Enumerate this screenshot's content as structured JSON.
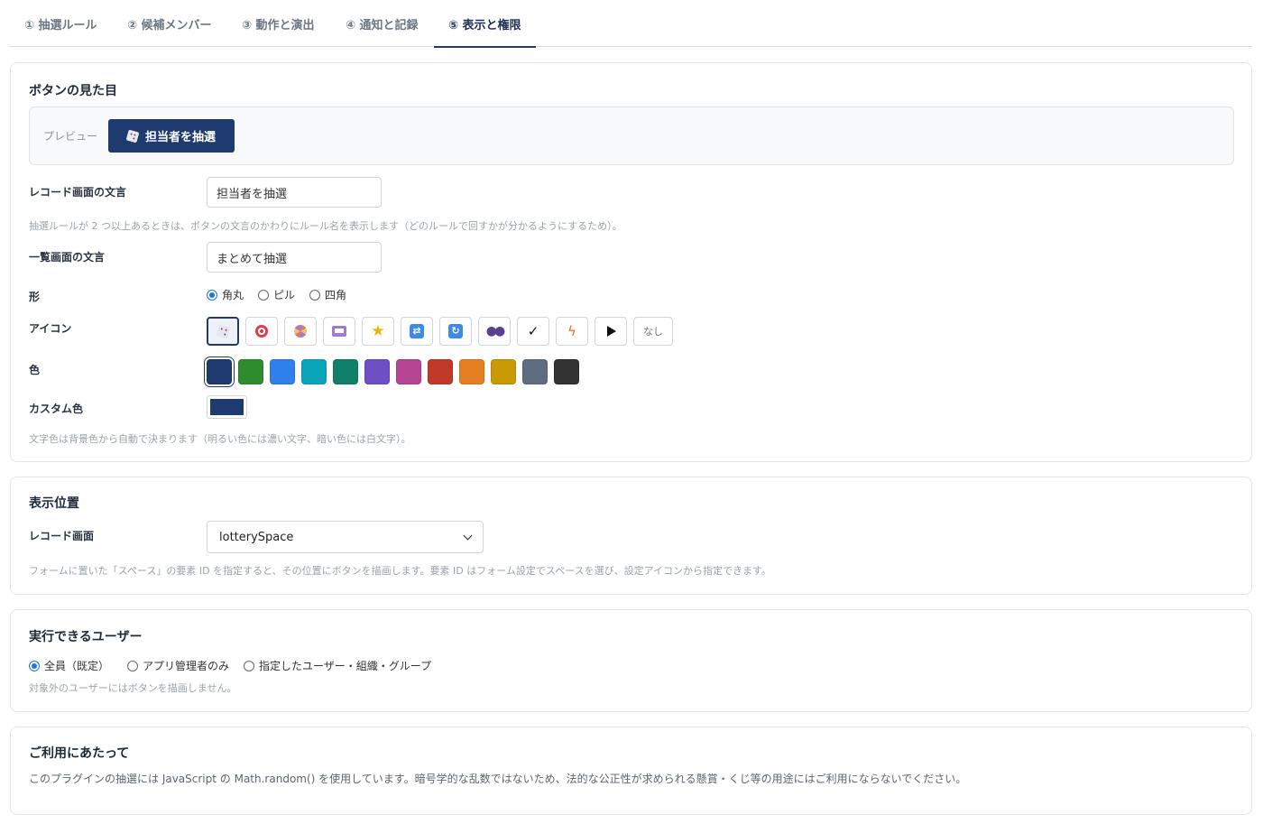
{
  "tabs": [
    {
      "label": "① 抽選ルール"
    },
    {
      "label": "② 候補メンバー"
    },
    {
      "label": "③ 動作と演出"
    },
    {
      "label": "④ 通知と記録"
    },
    {
      "label": "⑤ 表示と権限"
    }
  ],
  "appearance": {
    "title": "ボタンの見た目",
    "preview_label": "プレビュー",
    "preview_button_label": "担当者を抽選",
    "record_label": "レコード画面の文言",
    "record_value": "担当者を抽選",
    "record_hint": "抽選ルールが 2 つ以上あるときは、ボタンの文言のかわりにルール名を表示します（どのルールで回すかが分かるようにするため）。",
    "list_label": "一覧画面の文言",
    "list_value": "まとめて抽選",
    "shape_label": "形",
    "shapes": [
      {
        "label": "角丸",
        "checked": true
      },
      {
        "label": "ピル",
        "checked": false
      },
      {
        "label": "四角",
        "checked": false
      }
    ],
    "icon_label": "アイコン",
    "icons": [
      "dice",
      "target",
      "wheel",
      "slot-machine",
      "star",
      "shuffle",
      "refresh",
      "users",
      "check",
      "bolt",
      "play",
      "none"
    ],
    "icon_none_label": "なし",
    "color_label": "色",
    "colors": [
      "#1e3a6e",
      "#2e8b2e",
      "#2f80ed",
      "#0aa5b8",
      "#11806b",
      "#6f4fc4",
      "#b54593",
      "#c0392b",
      "#e67e22",
      "#c99a06",
      "#5e6e80",
      "#333333"
    ],
    "custom_color_label": "カスタム色",
    "custom_color": "#1e3a6e",
    "color_hint": "文字色は背景色から自動で決まります（明るい色には濃い文字、暗い色には白文字）。"
  },
  "position": {
    "title": "表示位置",
    "record_label": "レコード画面",
    "select_value": "lotterySpace",
    "hint": "フォームに置いた「スペース」の要素 ID を指定すると、その位置にボタンを描画します。要素 ID はフォーム設定でスペースを選び、設定アイコンから指定できます。"
  },
  "users": {
    "title": "実行できるユーザー",
    "options": [
      {
        "label": "全員（既定）",
        "checked": true
      },
      {
        "label": "アプリ管理者のみ",
        "checked": false
      },
      {
        "label": "指定したユーザー・組織・グループ",
        "checked": false
      }
    ],
    "hint": "対象外のユーザーにはボタンを描画しません。"
  },
  "usage": {
    "title": "ご利用にあたって",
    "body": "このプラグインの抽選には JavaScript の Math.random() を使用しています。暗号学的な乱数ではないため、法的な公正性が求められる懸賞・くじ等の用途にはご利用にならないでください。"
  }
}
